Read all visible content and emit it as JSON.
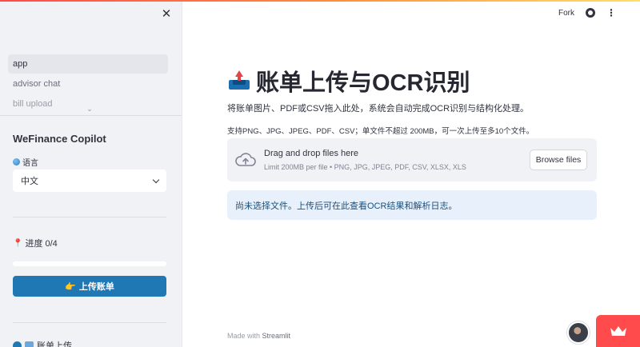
{
  "sidebar": {
    "close_glyph": "✕",
    "nav_items": [
      {
        "label": "app",
        "active": true
      },
      {
        "label": "advisor chat",
        "active": false
      },
      {
        "label": "bill upload",
        "active": false
      }
    ],
    "title": "WeFinance Copilot",
    "language_label": "语言",
    "language_value": "中文",
    "progress_label": "进度 0/4",
    "progress_fraction": 0,
    "upload_button": "上传账单",
    "step_label": "账单上传"
  },
  "header": {
    "fork_label": "Fork",
    "icons": [
      "github-icon",
      "kebab-menu-icon"
    ]
  },
  "main": {
    "title": "账单上传与OCR识别",
    "description": "将账单图片、PDF或CSV拖入此处，系统会自动完成OCR识别与结构化处理。",
    "hint": "支持PNG、JPG、JPEG、PDF、CSV；单文件不超过 200MB，可一次上传至多10个文件。",
    "dropzone": {
      "main_text": "Drag and drop files here",
      "sub_text": "Limit 200MB per file • PNG, JPG, JPEG, PDF, CSV, XLSX, XLS",
      "browse_label": "Browse files"
    },
    "info_text": "尚未选择文件。上传后可在此查看OCR结果和解析日志。"
  },
  "footer": {
    "prefix": "Made with",
    "brand": "Streamlit"
  },
  "colors": {
    "primary": "#1f77b4",
    "accent": "#ff4b4b",
    "sidebar_bg": "#f0f2f6",
    "info_bg": "#e8f1fb"
  }
}
